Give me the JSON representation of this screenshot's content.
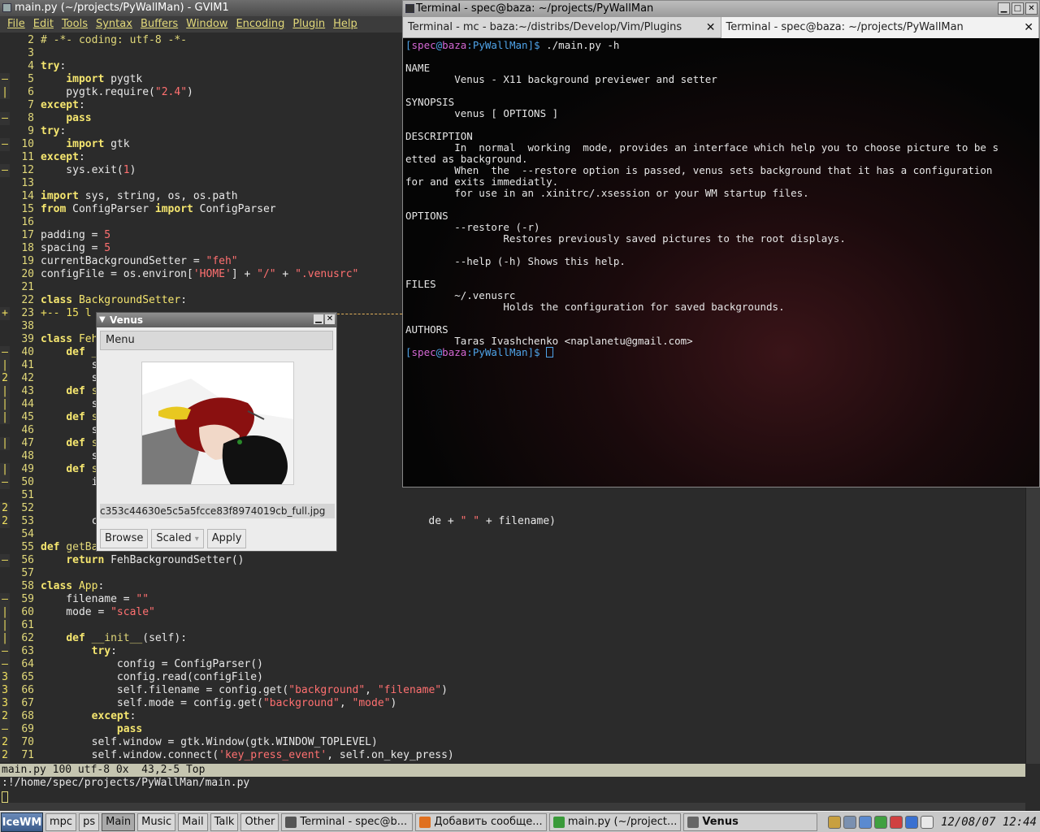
{
  "gvim": {
    "title": "main.py (~/projects/PyWallMan) - GVIM1",
    "menu": [
      "File",
      "Edit",
      "Tools",
      "Syntax",
      "Buffers",
      "Window",
      "Encoding",
      "Plugin",
      "Help"
    ],
    "lines": [
      {
        "f": "",
        "n": "2",
        "h": "<span class='cmt'># -*- coding: utf-8 -*-</span>"
      },
      {
        "f": "",
        "n": "3",
        "h": ""
      },
      {
        "f": "",
        "n": "4",
        "h": "<span class='kw'>try</span>:"
      },
      {
        "f": "–",
        "n": "5",
        "h": "    <span class='kw'>import</span> pygtk"
      },
      {
        "f": "|",
        "n": "6",
        "h": "    pygtk.require(<span class='str'>\"2.4\"</span>)"
      },
      {
        "f": "",
        "n": "7",
        "h": "<span class='kw'>except</span>:"
      },
      {
        "f": "–",
        "n": "8",
        "h": "    <span class='kw'>pass</span>"
      },
      {
        "f": "",
        "n": "9",
        "h": "<span class='kw'>try</span>:"
      },
      {
        "f": "–",
        "n": "10",
        "h": "    <span class='kw'>import</span> gtk"
      },
      {
        "f": "",
        "n": "11",
        "h": "<span class='kw'>except</span>:"
      },
      {
        "f": "–",
        "n": "12",
        "h": "    sys.exit(<span class='num-l'>1</span>)"
      },
      {
        "f": "",
        "n": "13",
        "h": ""
      },
      {
        "f": "",
        "n": "14",
        "h": "<span class='kw'>import</span> sys, string, os, os.path"
      },
      {
        "f": "",
        "n": "15",
        "h": "<span class='kw'>from</span> ConfigParser <span class='kw'>import</span> ConfigParser"
      },
      {
        "f": "",
        "n": "16",
        "h": ""
      },
      {
        "f": "",
        "n": "17",
        "h": "padding = <span class='num-l'>5</span>"
      },
      {
        "f": "",
        "n": "18",
        "h": "spacing = <span class='num-l'>5</span>"
      },
      {
        "f": "",
        "n": "19",
        "h": "currentBackgroundSetter = <span class='str'>\"feh\"</span>"
      },
      {
        "f": "",
        "n": "20",
        "h": "configFile = os.environ[<span class='str'>'HOME'</span>] + <span class='str'>\"/\"</span> + <span class='str'>\".venusrc\"</span>"
      },
      {
        "f": "",
        "n": "21",
        "h": ""
      },
      {
        "f": "",
        "n": "22",
        "h": "<span class='kw'>class</span> <span class='cls'>BackgroundSetter</span>:"
      },
      {
        "f": "+",
        "n": "23",
        "h": "<span class='foldtxt'>+-- 15 l</span>",
        "fold": true
      },
      {
        "f": "",
        "n": "38",
        "h": ""
      },
      {
        "f": "",
        "n": "39",
        "h": "<span class='kw'>class</span> <span class='cls'>Feh</span>"
      },
      {
        "f": "–",
        "n": "40",
        "h": "    <span class='kw'>def</span> <span class='fn'>_</span>"
      },
      {
        "f": "|",
        "n": "41",
        "h": "        s"
      },
      {
        "f": "2",
        "n": "42",
        "h": "        s"
      },
      {
        "f": "|",
        "n": "43",
        "h": "    <span class='kw'>def</span> <span class='fn'>s</span>"
      },
      {
        "f": "|",
        "n": "44",
        "h": "        s"
      },
      {
        "f": "|",
        "n": "45",
        "h": "    <span class='kw'>def</span> <span class='fn'>s</span>"
      },
      {
        "f": "",
        "n": "46",
        "h": "        s"
      },
      {
        "f": "|",
        "n": "47",
        "h": "    <span class='kw'>def</span> <span class='fn'>s</span>"
      },
      {
        "f": "",
        "n": "48",
        "h": "        s"
      },
      {
        "f": "|",
        "n": "49",
        "h": "    <span class='kw'>def</span> <span class='fn'>s</span>"
      },
      {
        "f": "–",
        "n": "50",
        "h": "        i"
      },
      {
        "f": "",
        "n": "51",
        "h": ""
      },
      {
        "f": "2",
        "n": "52",
        "h": ""
      },
      {
        "f": "2",
        "n": "53",
        "h": "        c                                                    de + <span class='str'>\" \"</span> + filename)"
      },
      {
        "f": "",
        "n": "54",
        "h": ""
      },
      {
        "f": "",
        "n": "55",
        "h": "<span class='kw'>def</span> <span class='fn'>getBa</span>"
      },
      {
        "f": "–",
        "n": "56",
        "h": "    <span class='kw'>return</span> FehBackgroundSetter()"
      },
      {
        "f": "",
        "n": "57",
        "h": ""
      },
      {
        "f": "",
        "n": "58",
        "h": "<span class='kw'>class</span> <span class='cls'>App</span>:"
      },
      {
        "f": "–",
        "n": "59",
        "h": "    filename = <span class='str'>\"\"</span>"
      },
      {
        "f": "|",
        "n": "60",
        "h": "    mode = <span class='str'>\"scale\"</span>"
      },
      {
        "f": "|",
        "n": "61",
        "h": ""
      },
      {
        "f": "|",
        "n": "62",
        "h": "    <span class='kw'>def</span> <span class='fn'>__init__</span>(self):"
      },
      {
        "f": "–",
        "n": "63",
        "h": "        <span class='kw'>try</span>:"
      },
      {
        "f": "–",
        "n": "64",
        "h": "            config = ConfigParser()"
      },
      {
        "f": "3",
        "n": "65",
        "h": "            config.read(configFile)"
      },
      {
        "f": "3",
        "n": "66",
        "h": "            self.filename = config.get(<span class='str'>\"background\"</span>, <span class='str'>\"filename\"</span>)"
      },
      {
        "f": "3",
        "n": "67",
        "h": "            self.mode = config.get(<span class='str'>\"background\"</span>, <span class='str'>\"mode\"</span>)"
      },
      {
        "f": "2",
        "n": "68",
        "h": "        <span class='kw'>except</span>:"
      },
      {
        "f": "–",
        "n": "69",
        "h": "            <span class='kw'>pass</span>"
      },
      {
        "f": "2",
        "n": "70",
        "h": "        self.window = gtk.Window(gtk.WINDOW_TOPLEVEL)"
      },
      {
        "f": "2",
        "n": "71",
        "h": "        self.window.connect(<span class='str'>'key_press_event'</span>, self.on_key_press)"
      }
    ],
    "statusline": "main.py 100 utf-8 0x  43,2-5 Top",
    "cmdline": ":!/home/spec/projects/PyWallMan/main.py"
  },
  "terminal": {
    "title": "Terminal - spec@baza: ~/projects/PyWallMan",
    "tabs": [
      {
        "label": "Terminal - mc - baza:~/distribs/Develop/Vim/Plugins",
        "active": false
      },
      {
        "label": "Terminal - spec@baza: ~/projects/PyWallMan",
        "active": true
      }
    ],
    "prompt_user": "spec",
    "prompt_host": "baza",
    "prompt_path": "PyWallMan",
    "command": "./main.py -h",
    "output": [
      "",
      "NAME",
      "        Venus - X11 background previewer and setter",
      "",
      "SYNOPSIS",
      "        venus [ OPTIONS ]",
      "",
      "DESCRIPTION",
      "        In  normal  working  mode, provides an interface which help you to choose picture to be s",
      "etted as background.",
      "        When  the  --restore option is passed, venus sets background that it has a configuration",
      "for and exits immediatly.",
      "        for use in an .xinitrc/.xsession or your WM startup files.",
      "",
      "OPTIONS",
      "        --restore (-r)",
      "                Restores previously saved pictures to the root displays.",
      "",
      "        --help (-h) Shows this help.",
      "",
      "FILES",
      "        ~/.venusrc",
      "                Holds the configuration for saved backgrounds.",
      "",
      "AUTHORS",
      "        Taras Ivashchenko <naplanetu@gmail.com>"
    ]
  },
  "venus": {
    "title": "Venus",
    "menu_label": "Menu",
    "filename": "c353c44630e5c5a5fcce83f8974019cb_full.jpg",
    "browse_label": "Browse",
    "mode_label": "Scaled",
    "apply_label": "Apply"
  },
  "taskbar": {
    "start_label": "IceWM",
    "workspaces": [
      {
        "label": "mpc",
        "active": false
      },
      {
        "label": "ps",
        "active": false
      },
      {
        "label": "Main",
        "active": true
      },
      {
        "label": "Music",
        "active": false
      },
      {
        "label": "Mail",
        "active": false
      },
      {
        "label": "Talk",
        "active": false
      },
      {
        "label": "Other",
        "active": false
      }
    ],
    "tasks": [
      {
        "label": "Terminal - spec@b...",
        "icon": "terminal-icon",
        "color": "#555555",
        "bold": false,
        "width": 162
      },
      {
        "label": "Добавить сообще...",
        "icon": "firefox-icon",
        "color": "#e07020",
        "bold": false,
        "width": 162
      },
      {
        "label": "main.py (~/project...",
        "icon": "vim-icon",
        "color": "#3a9a3a",
        "bold": false,
        "width": 162
      },
      {
        "label": "Venus",
        "icon": "x-icon",
        "color": "#666666",
        "bold": true,
        "width": 165
      }
    ],
    "clock": "12/08/07 12:44",
    "tray_colors": [
      "#c8a040",
      "#7a90b0",
      "#5a8ad0",
      "#40a040",
      "#d04040",
      "#3a70d0",
      "#e8e8e8"
    ]
  }
}
